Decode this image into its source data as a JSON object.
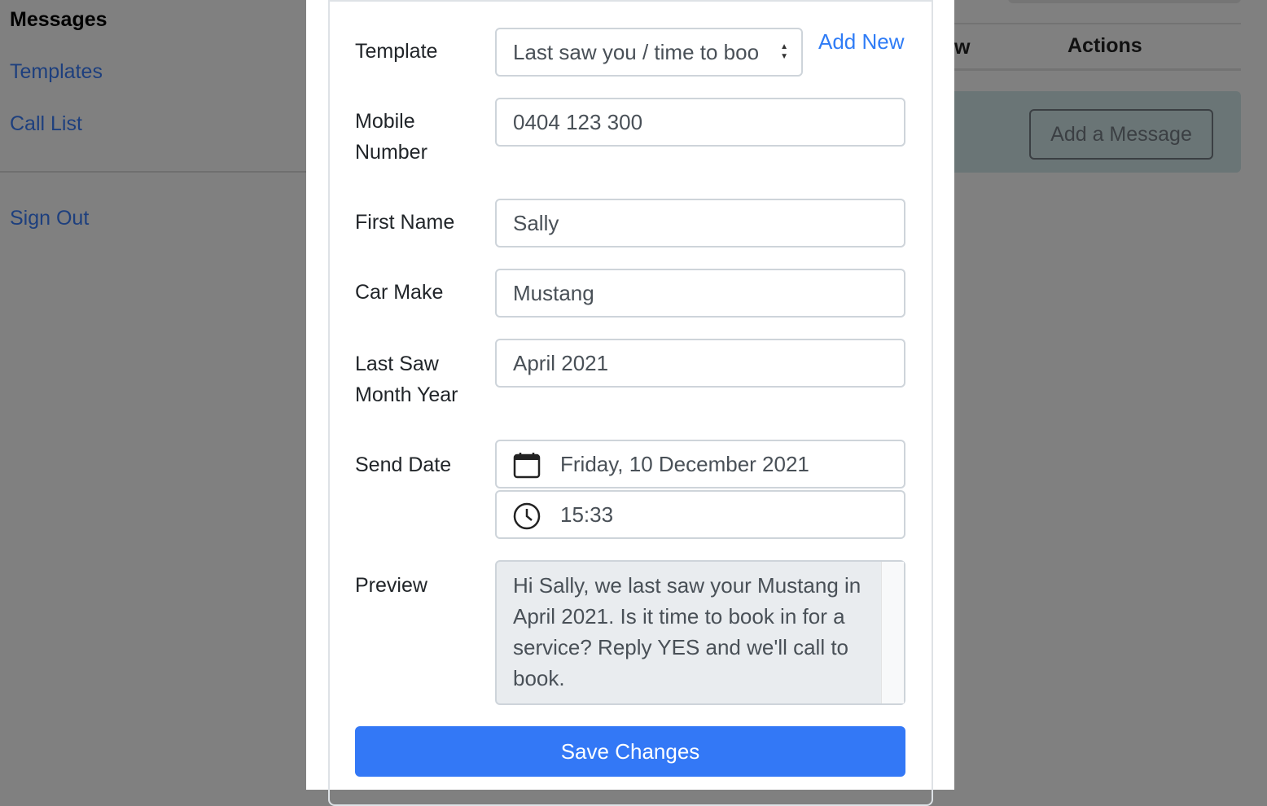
{
  "sidebar": {
    "title": "Messages",
    "items": [
      {
        "label": "Templates"
      },
      {
        "label": "Call List"
      }
    ],
    "sign_out": "Sign Out"
  },
  "background": {
    "partial_column": "w",
    "actions_header": "Actions",
    "add_message_button": "Add a Message"
  },
  "form": {
    "template_label": "Template",
    "template_value": "Last saw you / time to boo",
    "add_new": "Add New",
    "mobile_label": "Mobile Number",
    "mobile_value": "0404 123 300",
    "first_name_label": "First Name",
    "first_name_value": "Sally",
    "car_make_label": "Car Make",
    "car_make_value": "Mustang",
    "last_saw_label": "Last Saw Month Year",
    "last_saw_value": "April 2021",
    "send_date_label": "Send Date",
    "send_date_value": "Friday, 10 December 2021",
    "send_time_value": "15:33",
    "preview_label": "Preview",
    "preview_text": "Hi Sally, we last saw your Mustang in April 2021. Is it time to book in for a service? Reply YES and we'll call to book.",
    "save_button": "Save Changes"
  },
  "colors": {
    "primary": "#3378f6",
    "link": "#2f7cf6",
    "overlay": "#808080"
  }
}
